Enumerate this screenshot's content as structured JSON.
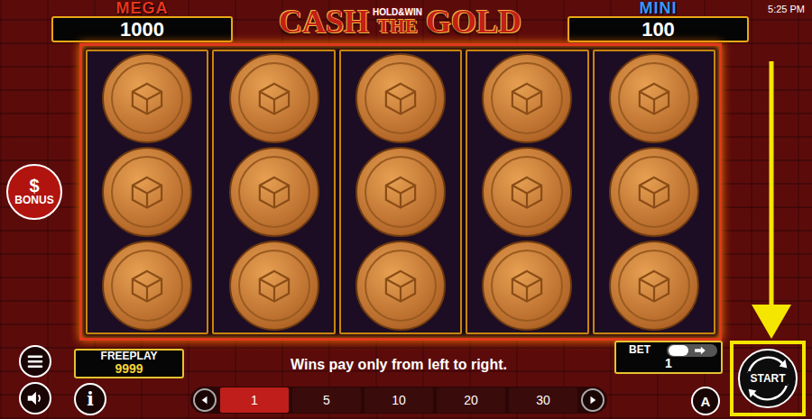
{
  "clock": "5:25 PM",
  "jackpots": [
    {
      "label": "MEGA",
      "value": "1000",
      "color": "#e8341c"
    },
    {
      "label": "MINI",
      "value": "100",
      "color": "#3a97ff"
    }
  ],
  "title": {
    "left": "CASH",
    "badge_top": "HOLD&WIN",
    "badge_bottom": "THE",
    "right": "GOLD"
  },
  "bonus_button": {
    "icon": "$",
    "label": "BONUS"
  },
  "reels": [
    {
      "symbols": [
        "coin",
        "coin",
        "coin"
      ]
    },
    {
      "symbols": [
        "coin",
        "coin",
        "coin"
      ]
    },
    {
      "symbols": [
        "coin",
        "coin",
        "coin"
      ]
    },
    {
      "symbols": [
        "coin",
        "coin",
        "coin"
      ]
    },
    {
      "symbols": [
        "coin",
        "coin",
        "coin"
      ]
    }
  ],
  "freeplay": {
    "label": "FREEPLAY",
    "value": "9999"
  },
  "message": "Wins pay only from left to right.",
  "bet": {
    "label": "BET",
    "value": "1",
    "toggle_on": false
  },
  "bet_options": [
    {
      "label": "1",
      "selected": true
    },
    {
      "label": "5",
      "selected": false
    },
    {
      "label": "10",
      "selected": false
    },
    {
      "label": "20",
      "selected": false
    },
    {
      "label": "30",
      "selected": false
    }
  ],
  "info_button": {
    "label": "i"
  },
  "autoplay_button": {
    "label": "A"
  },
  "start_button": {
    "label": "START",
    "highlighted": true
  }
}
